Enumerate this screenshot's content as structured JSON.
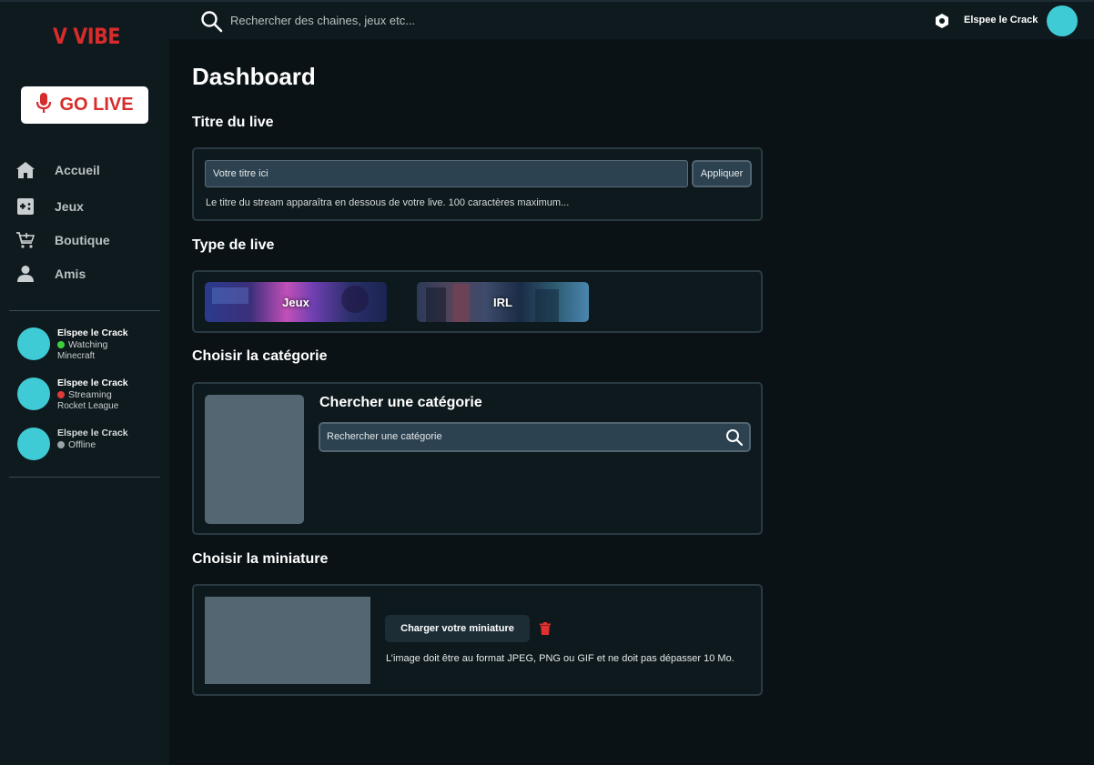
{
  "app": {
    "logo": "V VIBE",
    "go_live_label": "GO LIVE"
  },
  "topbar": {
    "search_placeholder": "Rechercher des chaines, jeux etc...",
    "user_name": "Elspee le Crack"
  },
  "sidebar": {
    "items": [
      {
        "label": "Accueil",
        "icon": "home-icon"
      },
      {
        "label": "Jeux",
        "icon": "gamepad-icon"
      },
      {
        "label": "Boutique",
        "icon": "cart-icon"
      },
      {
        "label": "Amis",
        "icon": "person-icon"
      }
    ],
    "friends": [
      {
        "name": "Elspee le Crack",
        "status": "Watching",
        "status_color": "#3ecf3e",
        "game": "Minecraft"
      },
      {
        "name": "Elspee le Crack",
        "status": "Streaming",
        "status_color": "#e03a3a",
        "game": "Rocket League"
      },
      {
        "name": "Elspee le Crack",
        "status": "Offline",
        "status_color": "#9aa3a8",
        "game": ""
      }
    ]
  },
  "main": {
    "page_title": "Dashboard",
    "sections": {
      "title": "Titre du live",
      "type": "Type de live",
      "category": "Choisir la catégorie",
      "thumbnail": "Choisir la miniature"
    },
    "title_card": {
      "input_placeholder": "Votre titre ici",
      "apply_label": "Appliquer",
      "hint": "Le titre du stream apparaîtra en dessous de votre live. 100 caractères maximum..."
    },
    "type_card": {
      "options": [
        "Jeux",
        "IRL"
      ]
    },
    "category_card": {
      "heading": "Chercher une catégorie",
      "search_placeholder": "Rechercher une catégorie"
    },
    "thumbnail_card": {
      "upload_label": "Charger votre miniature",
      "hint": "L’image doit être au format JPEG, PNG ou GIF et ne doit pas dépasser 10 Mo."
    }
  },
  "colors": {
    "accent_red": "#d82b2b",
    "avatar": "#3fcbd6",
    "background": "#0a1216"
  }
}
